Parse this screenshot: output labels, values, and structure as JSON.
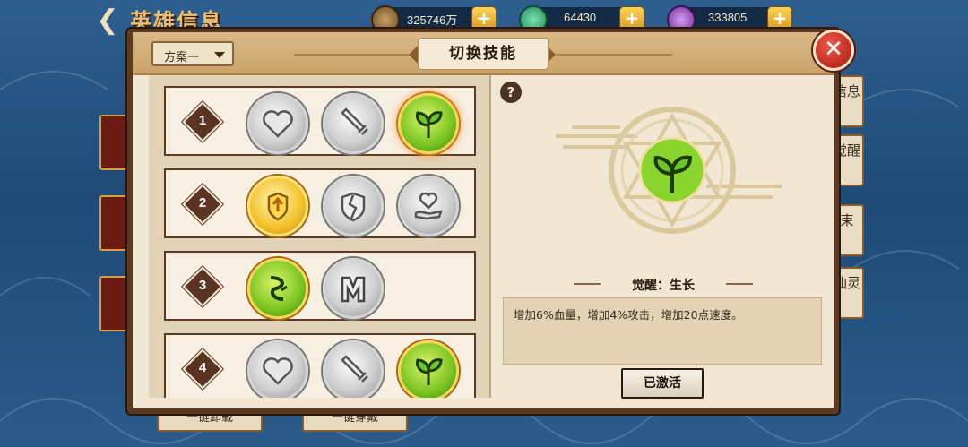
{
  "header": {
    "title": "英雄信息",
    "resources": [
      {
        "icon": "copper-coin-icon",
        "value": "325746万"
      },
      {
        "icon": "jade-icon",
        "value": "64430"
      },
      {
        "icon": "purple-gem-icon",
        "value": "333805"
      }
    ]
  },
  "side_tabs_right": [
    "信息",
    "觉醒",
    "束",
    "仙灵"
  ],
  "under_buttons": [
    "一键卸载",
    "一键穿戴"
  ],
  "panel": {
    "title": "切换技能",
    "scheme_dropdown": "方案一",
    "rows": [
      {
        "num": "1",
        "skills": [
          {
            "style": "silver",
            "icon": "heart-icon"
          },
          {
            "style": "silver",
            "icon": "sword-icon"
          },
          {
            "style": "green",
            "icon": "sprout-icon"
          }
        ]
      },
      {
        "num": "2",
        "skills": [
          {
            "style": "gold",
            "icon": "shield-wing-icon"
          },
          {
            "style": "silver",
            "icon": "broken-shield-icon"
          },
          {
            "style": "silver",
            "icon": "heart-hand-icon"
          }
        ]
      },
      {
        "num": "3",
        "skills": [
          {
            "style": "green-plain",
            "icon": "vine-icon"
          },
          {
            "style": "silver",
            "icon": "pillar-icon"
          }
        ]
      },
      {
        "num": "4",
        "skills": [
          {
            "style": "silver",
            "icon": "heart-icon"
          },
          {
            "style": "silver",
            "icon": "sword-icon"
          },
          {
            "style": "green-plain",
            "icon": "sprout-icon"
          }
        ]
      }
    ],
    "detail": {
      "help": "?",
      "awake_title": "觉醒：生长",
      "description": "增加6%血量，增加4%攻击，增加20点速度。",
      "activate_button": "已激活"
    }
  }
}
